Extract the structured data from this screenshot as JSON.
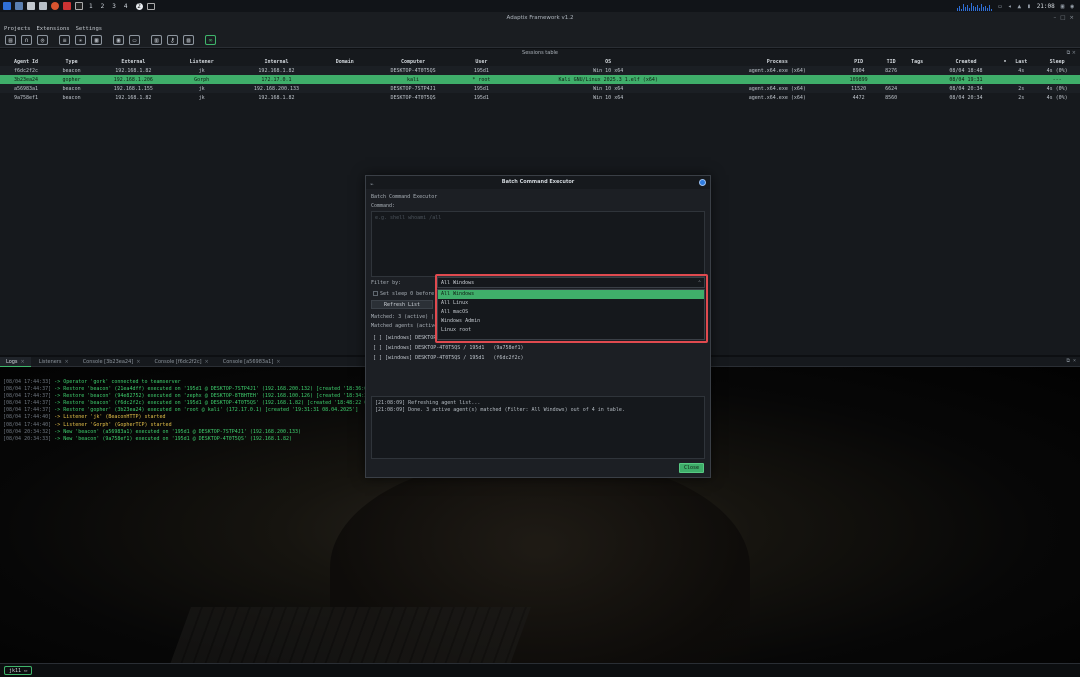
{
  "sysbar": {
    "workspaces": [
      "1",
      "2",
      "3",
      "4"
    ],
    "badge": "2",
    "time": "21:08"
  },
  "window": {
    "title": "Adaptix Framework v1.2"
  },
  "menu": {
    "items": [
      "Projects",
      "Extensions",
      "Settings"
    ]
  },
  "toolbar": {
    "icons": [
      "new-icon",
      "headphones-icon",
      "plugin-icon",
      "list-icon",
      "graph-icon",
      "sessions-icon",
      "terminal-icon",
      "screenshot-icon",
      "tasks-icon",
      "key-icon",
      "image-icon",
      "link-icon"
    ]
  },
  "sessions": {
    "caption": "Sessions table",
    "columns": [
      "Agent Id",
      "Type",
      "External",
      "Listener",
      "Internal",
      "Domain",
      "Computer",
      "User",
      "OS",
      "Process",
      "PID",
      "TID",
      "Tags",
      "Created",
      "•",
      "Last",
      "Sleep"
    ],
    "rows": [
      {
        "id": "f6dc2f2c",
        "type": "beacon",
        "external": "192.168.1.82",
        "listener": "jk",
        "internal": "192.168.1.82",
        "domain": "",
        "computer": "DESKTOP-4T0T5QS",
        "user": "195d1",
        "os": "Win 10 x64",
        "process": "agent.x64.exe (x64)",
        "pid": "8904",
        "tid": "8276",
        "tags": "",
        "created": "08/04 18:48",
        "last": "4s",
        "sleep": "4s (0%)",
        "selected": false
      },
      {
        "id": "3b23ea24",
        "type": "gopher",
        "external": "192.168.1.206",
        "listener": "Gorph",
        "internal": "172.17.0.1",
        "domain": "",
        "computer": "kali",
        "user": "* root",
        "os": "Kali GNU/Linux 2025.3 1.elf (x64)",
        "process": "",
        "pid": "109899",
        "tid": "",
        "tags": "",
        "created": "08/04 19:31",
        "last": "",
        "sleep": "---",
        "selected": true
      },
      {
        "id": "a56983a1",
        "type": "beacon",
        "external": "192.168.1.155",
        "listener": "jk",
        "internal": "192.168.200.133",
        "domain": "",
        "computer": "DESKTOP-7STP4J1",
        "user": "195d1",
        "os": "Win 10 x64",
        "process": "agent.x64.exe (x64)",
        "pid": "11520",
        "tid": "6624",
        "tags": "",
        "created": "08/04 20:34",
        "last": "2s",
        "sleep": "4s (0%)",
        "selected": false
      },
      {
        "id": "9a758ef1",
        "type": "beacon",
        "external": "192.168.1.82",
        "listener": "jk",
        "internal": "192.168.1.82",
        "domain": "",
        "computer": "DESKTOP-4T0T5QS",
        "user": "195d1",
        "os": "Win 10 x64",
        "process": "agent.x64.exe (x64)",
        "pid": "4472",
        "tid": "8560",
        "tags": "",
        "created": "08/04 20:34",
        "last": "2s",
        "sleep": "4s (0%)",
        "selected": false
      }
    ]
  },
  "dock": {
    "tabs": [
      {
        "label": "Logs",
        "active": true
      },
      {
        "label": "Listeners",
        "active": false
      },
      {
        "label": "Console [3b23ea24]",
        "active": false
      },
      {
        "label": "Console [f6dc2f2c]",
        "active": false
      },
      {
        "label": "Console [a56983a1]",
        "active": false
      }
    ],
    "logs": [
      {
        "ts": "[08/04 17:44:33]",
        "text": " -> Operator 'gork' connected to teamserver",
        "color": "g"
      },
      {
        "ts": "[08/04 17:44:37]",
        "text": " -> Restore 'beacon' (21ea4dff) executed on '195d1 @ DESKTOP-7STP4J1' (192.168.200.132) [created '18:36:0",
        "color": "g"
      },
      {
        "ts": "[08/04 17:44:37]",
        "text": " -> Restore 'beacon' (94e82752) executed on 'zephx @ DESKTOP-8TBHTEH' (192.168.100.126) [created '18:34:3",
        "color": "g"
      },
      {
        "ts": "[08/04 17:44:37]",
        "text": " -> Restore 'beacon' (f6dc2f2c) executed on '195d1 @ DESKTOP-4T0T5QS' (192.168.1.82) [created '18:48:22 0",
        "color": "g"
      },
      {
        "ts": "[08/04 17:44:37]",
        "text": " -> Restore 'gopher' (3b23ea24) executed on 'root @ kali' (172.17.0.1) [created '19:31:31 08.04.2025']",
        "color": "g"
      },
      {
        "ts": "[08/04 17:44:40]",
        "text": " -> Listener 'jk' (BeaconHTTP) started",
        "color": "y"
      },
      {
        "ts": "[08/04 17:44:40]",
        "text": " -> Listener 'Gorph' (GopherTCP) started",
        "color": "y"
      },
      {
        "ts": "[08/04 20:34:32]",
        "text": " -> New 'beacon' (a56983a1) executed on '195d1 @ DESKTOP-7STP4J1' (192.168.200.133)",
        "color": "g"
      },
      {
        "ts": "[08/04 20:34:33]",
        "text": " -> New 'beacon' (9a758ef1) executed on '195d1 @ DESKTOP-4T0T5QS' (192.168.1.82)",
        "color": "g"
      }
    ]
  },
  "status": {
    "user": "jk11"
  },
  "dialog": {
    "title": "Batch Command Executor",
    "heading": "Batch Command Executor",
    "command_label": "Command:",
    "command_placeholder": "e.g. shell whoami /all",
    "filter_label": "Filter by:",
    "filter_value": "All Windows",
    "filter_options": [
      "All Windows",
      "All Linux",
      "All macOS",
      "Windows Admin",
      "Linux root"
    ],
    "sleep_label": "Set sleep 0 before",
    "refresh_label": "Refresh List",
    "matched_summary": "Matched: 3 (active) |",
    "matched_agents_label": "Matched agents (active",
    "agents": [
      "[ ] [windows] DESKTOP-",
      "[ ] [windows] DESKTOP-4T0T5QS / 195d1   (9a758ef1)",
      "[ ] [windows] DESKTOP-4T0T5QS / 195d1   (f6dc2f2c)"
    ],
    "output": [
      "[21:08:09] Refreshing agent list...",
      "[21:08:09] Done. 3 active agent(s) matched (Filter: All Windows) out of 4 in table."
    ],
    "close_label": "Close"
  }
}
